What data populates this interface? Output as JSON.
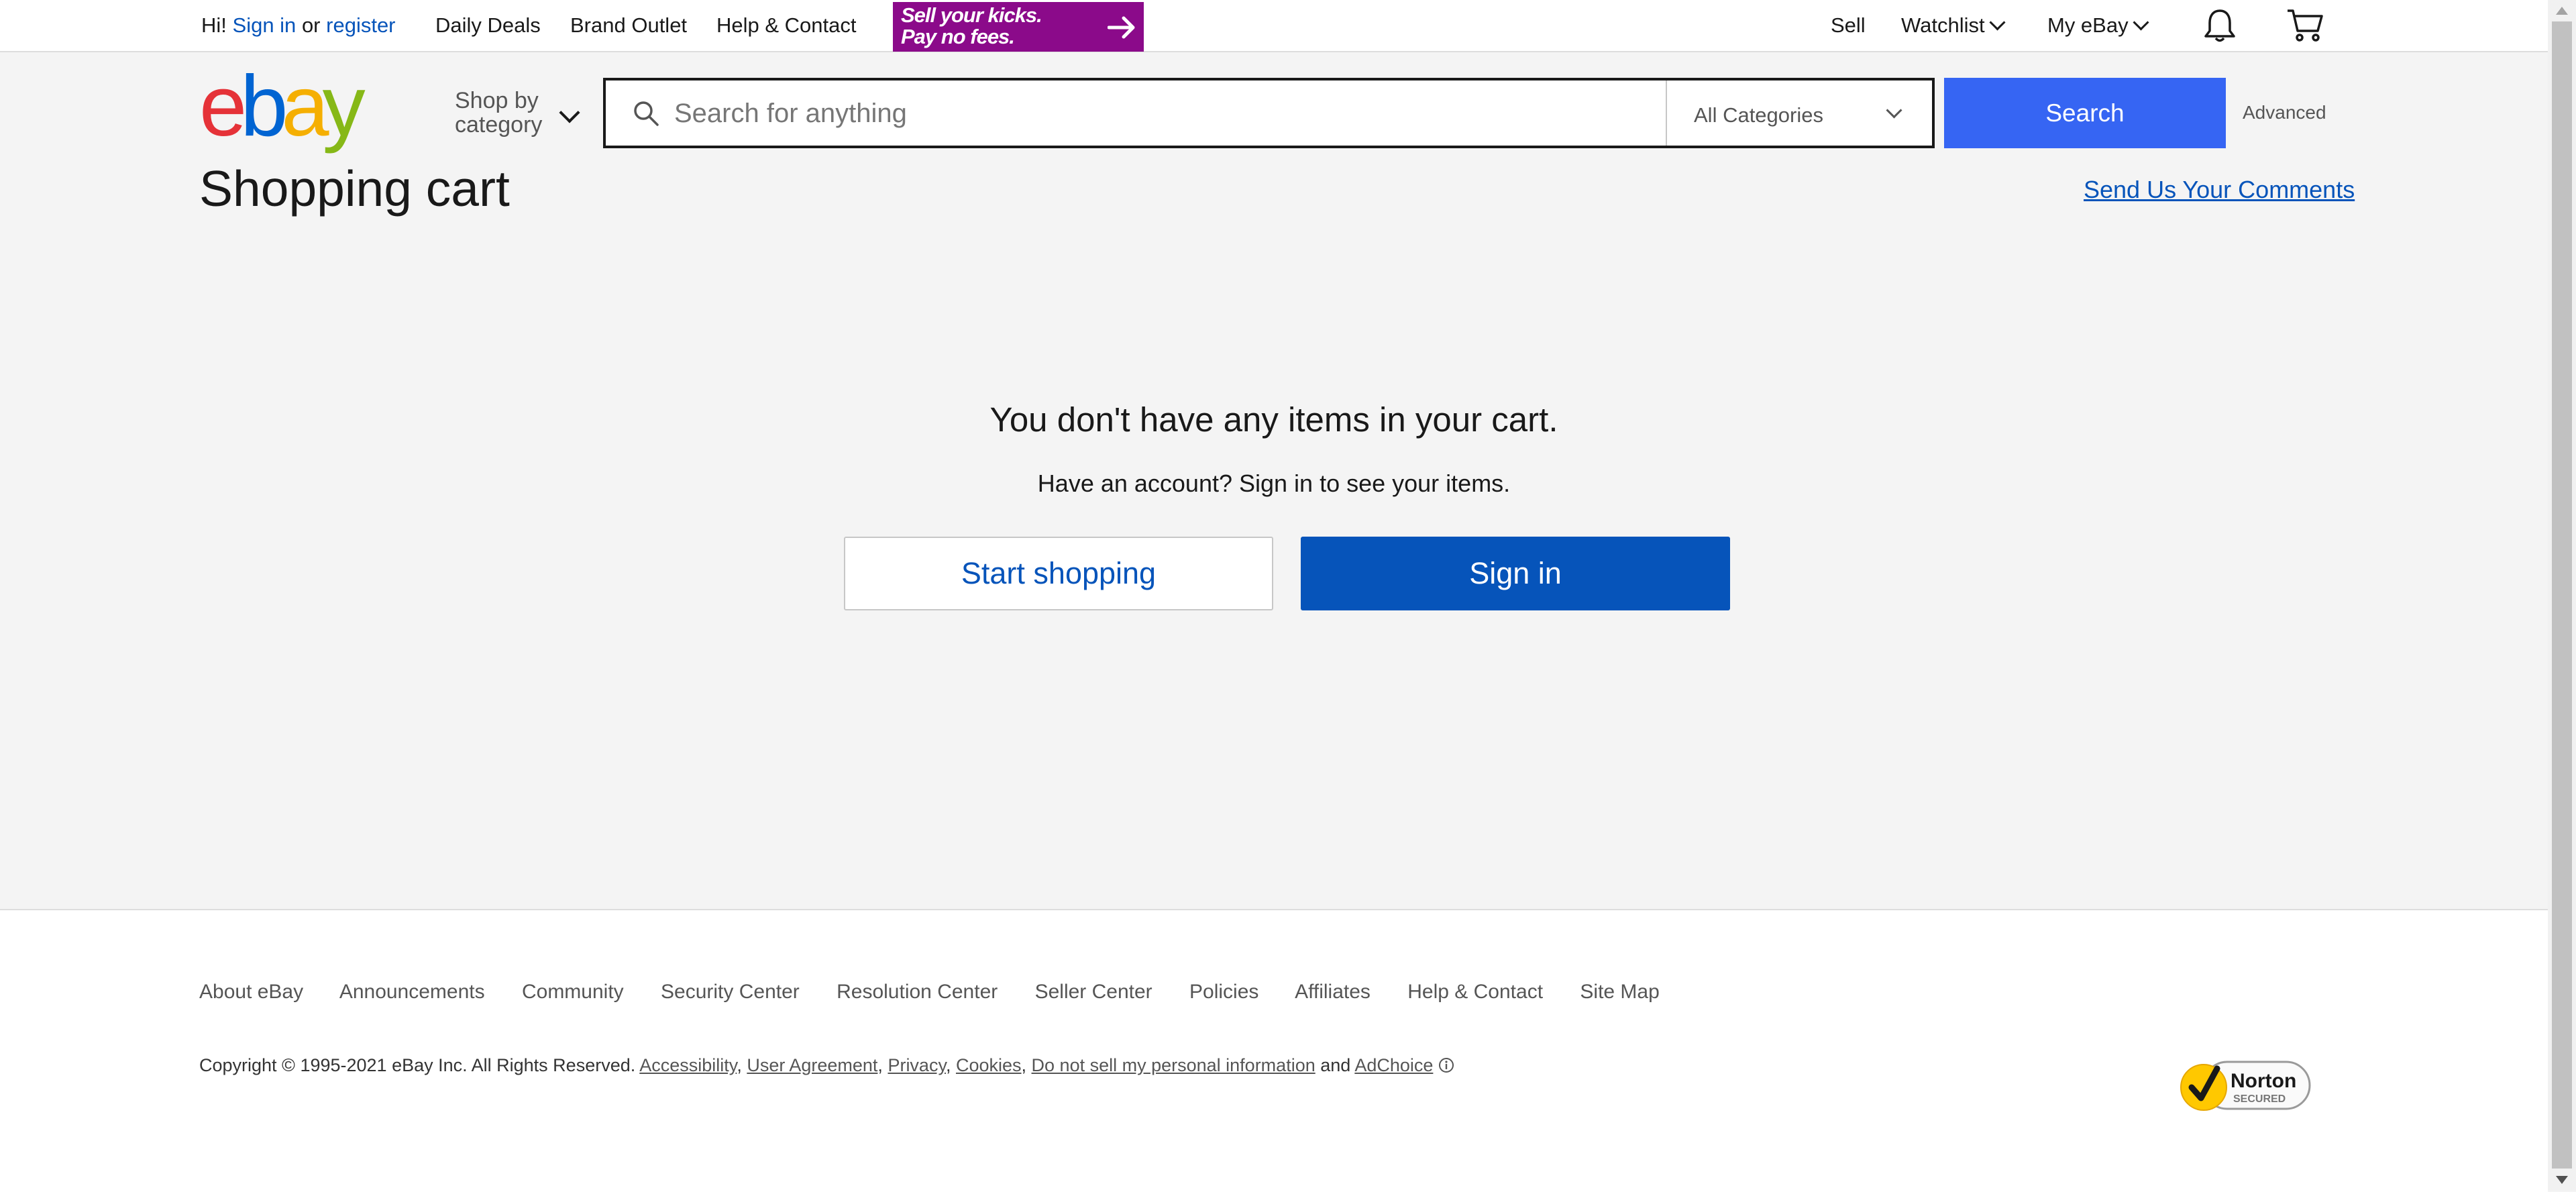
{
  "topbar": {
    "greeting_prefix": "Hi!",
    "sign_in": "Sign in",
    "or": "or",
    "register": "register",
    "daily_deals": "Daily Deals",
    "brand_outlet": "Brand Outlet",
    "help_contact": "Help & Contact",
    "promo_line1": "Sell your kicks.",
    "promo_line2": "Pay no fees.",
    "sell": "Sell",
    "watchlist": "Watchlist",
    "my_ebay": "My eBay",
    "icons": [
      "notification-bell-icon",
      "shopping-cart-icon"
    ]
  },
  "header": {
    "logo_letters": [
      "e",
      "b",
      "a",
      "y"
    ],
    "logo_colors": [
      "#e53238",
      "#0064d2",
      "#f5af02",
      "#86b817"
    ],
    "shop_by_line1": "Shop by",
    "shop_by_line2": "category",
    "search_placeholder": "Search for anything",
    "search_value": "",
    "category_selected": "All Categories",
    "search_button": "Search",
    "advanced": "Advanced"
  },
  "page": {
    "title": "Shopping cart",
    "send_comments": "Send Us Your Comments",
    "empty_message": "You don't have any items in your cart.",
    "empty_sub": "Have an account? Sign in to see your items.",
    "start_shopping": "Start shopping",
    "sign_in_button": "Sign in"
  },
  "footer": {
    "links": [
      "About eBay",
      "Announcements",
      "Community",
      "Security Center",
      "Resolution Center",
      "Seller Center",
      "Policies",
      "Affiliates",
      "Help & Contact",
      "Site Map"
    ],
    "copyright": "Copyright © 1995-2021 eBay Inc. All Rights Reserved.",
    "legal_links": [
      "Accessibility",
      "User Agreement",
      "Privacy",
      "Cookies",
      "Do not sell my personal information"
    ],
    "and": "and",
    "adchoice": "AdChoice",
    "norton_line1": "Norton",
    "norton_line2": "SECURED"
  },
  "colors": {
    "link": "#0654ba",
    "search_button": "#3665f3",
    "primary_button": "#0654ba",
    "promo_bg": "#8b0a8a"
  }
}
